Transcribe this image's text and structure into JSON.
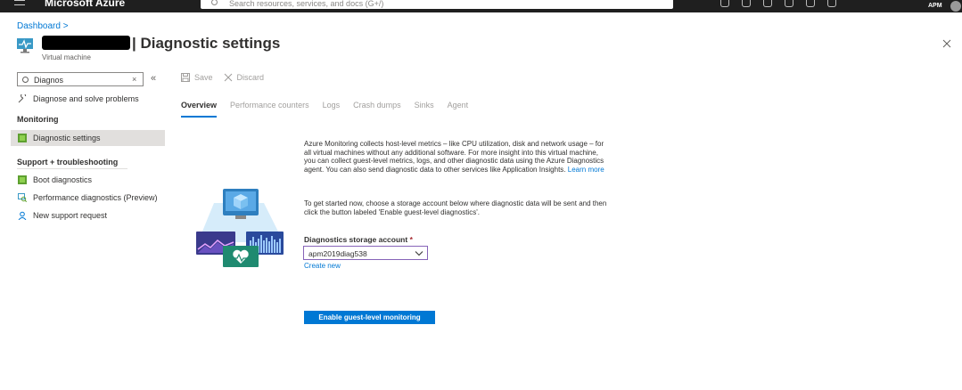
{
  "topbar": {
    "brand": "Microsoft Azure",
    "search_placeholder": "Search resources, services, and docs (G+/)",
    "account": "APM"
  },
  "breadcrumb": "Dashboard >",
  "header": {
    "title": "| Diagnostic settings",
    "subtitle": "Virtual machine"
  },
  "sidebar": {
    "search_value": "Diagnos",
    "search_clear": "×",
    "collapse": "«",
    "top_item": "Diagnose and solve problems",
    "monitoring_heading": "Monitoring",
    "monitoring_item": "Diagnostic settings",
    "support_heading": "Support + troubleshooting",
    "support_items": [
      "Boot diagnostics",
      "Performance diagnostics (Preview)",
      "New support request"
    ]
  },
  "toolbar": {
    "save": "Save",
    "discard": "Discard"
  },
  "tabs": [
    "Overview",
    "Performance counters",
    "Logs",
    "Crash dumps",
    "Sinks",
    "Agent"
  ],
  "active_tab": "Overview",
  "main": {
    "intro_text": "Azure Monitoring collects host-level metrics – like CPU utilization, disk and network usage – for all virtual machines without any additional software. For more insight into this virtual machine, you can collect guest-level metrics, logs, and other diagnostic data using the Azure Diagnostics agent. You can also send diagnostic data to other services like Application Insights.",
    "learn_more": "Learn more",
    "paragraph2": "To get started now, choose a storage account below where diagnostic data will be sent and then click the button labeled 'Enable guest-level diagnostics'.",
    "storage_label": "Diagnostics storage account",
    "required_marker": "*",
    "storage_value": "apm2019diag538",
    "create_new": "Create new",
    "enable_button": "Enable guest-level monitoring"
  },
  "colors": {
    "accent": "#0078d4",
    "topbar": "#1f1f1f",
    "select_border": "#8764b8"
  }
}
